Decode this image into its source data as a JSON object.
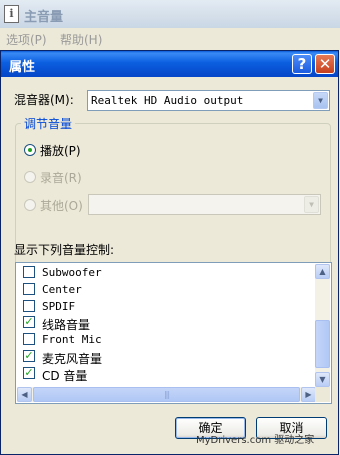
{
  "main_window": {
    "icon_glyph": "i",
    "title": "主音量",
    "menu": [
      "选项(P)",
      "帮助(H)"
    ]
  },
  "dialog": {
    "title": "属性",
    "help_glyph": "?",
    "close_glyph": "✕",
    "mixer_label": "混音器(M):",
    "mixer_value": "Realtek HD Audio output",
    "group_title": "调节音量",
    "radios": [
      {
        "label": "播放(P)",
        "checked": true,
        "enabled": true
      },
      {
        "label": "录音(R)",
        "checked": false,
        "enabled": false
      },
      {
        "label": "其他(O)",
        "checked": false,
        "enabled": false
      }
    ],
    "other_value": "",
    "list_label": "显示下列音量控制:",
    "list_items": [
      {
        "label": "Subwoofer",
        "checked": false
      },
      {
        "label": "Center",
        "checked": false
      },
      {
        "label": "SPDIF",
        "checked": false
      },
      {
        "label": "线路音量",
        "checked": true
      },
      {
        "label": "Front Mic",
        "checked": false
      },
      {
        "label": "麦克风音量",
        "checked": true
      },
      {
        "label": "CD 音量",
        "checked": true
      }
    ],
    "ok_label": "确定",
    "cancel_label": "取消"
  },
  "watermark": "MyDrivers.com 驱动之家",
  "icons": {
    "dropdown": "chevron-down-icon",
    "scroll_up": "arrow-up-icon",
    "scroll_down": "arrow-down-icon",
    "scroll_left": "arrow-left-icon",
    "scroll_right": "arrow-right-icon",
    "check": "checkmark-icon"
  },
  "colors": {
    "titlebar_blue": "#0b5fe0",
    "dialog_bg": "#ece9d8",
    "group_title": "#0046d5",
    "check_green": "#21a121",
    "close_red": "#c6401d"
  }
}
